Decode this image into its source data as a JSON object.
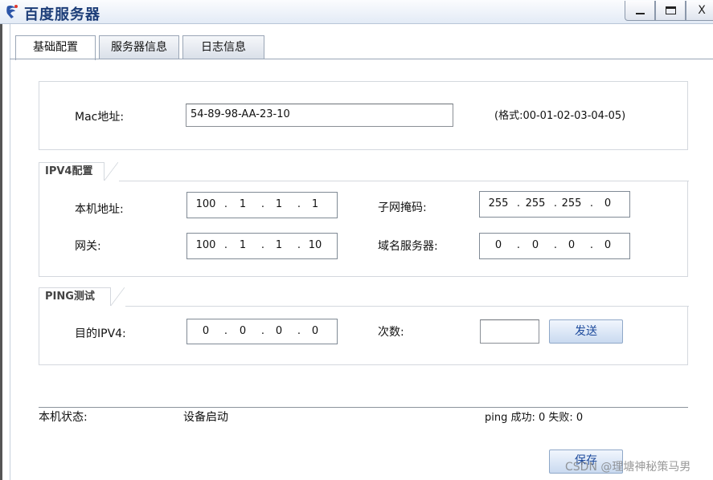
{
  "window": {
    "title": "百度服务器",
    "minimize_label": "–",
    "maximize_label": "□",
    "close_label": "X"
  },
  "tabs": [
    {
      "label": "基础配置",
      "active": true
    },
    {
      "label": "服务器信息",
      "active": false
    },
    {
      "label": "日志信息",
      "active": false
    }
  ],
  "mac_section": {
    "label": "Mac地址:",
    "value": "54-89-98-AA-23-10",
    "format_hint": "(格式:00-01-02-03-04-05)"
  },
  "ipv4_section": {
    "title": "IPV4配置",
    "local_address": {
      "label": "本机地址:",
      "octets": [
        "100",
        "1",
        "1",
        "1"
      ]
    },
    "subnet_mask": {
      "label": "子网掩码:",
      "octets": [
        "255",
        "255",
        "255",
        "0"
      ]
    },
    "gateway": {
      "label": "网关:",
      "octets": [
        "100",
        "1",
        "1",
        "10"
      ]
    },
    "dns_server": {
      "label": "域名服务器:",
      "octets": [
        "0",
        "0",
        "0",
        "0"
      ]
    }
  },
  "ping_section": {
    "title": "PING测试",
    "target": {
      "label": "目的IPV4:",
      "octets": [
        "0",
        "0",
        "0",
        "0"
      ]
    },
    "count": {
      "label": "次数:",
      "value": ""
    },
    "send_label": "发送"
  },
  "status": {
    "label": "本机状态:",
    "value": "设备启动",
    "ping_result": "ping 成功: 0 失败: 0"
  },
  "save_label": "保存",
  "watermark": "CSDN @理塘神秘策马男",
  "colors": {
    "accent": "#1d4a9c",
    "title": "#1c3d78"
  }
}
